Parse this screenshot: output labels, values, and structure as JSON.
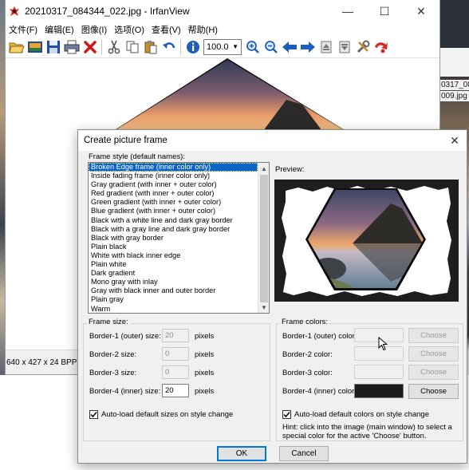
{
  "main_window": {
    "title": "20210317_084344_022.jpg - IrfanView",
    "controls": {
      "minimize": "—",
      "maximize": "☐",
      "close": "✕"
    },
    "menu": [
      "文件(F)",
      "编辑(E)",
      "图像(I)",
      "选项(O)",
      "查看(V)",
      "帮助(H)"
    ],
    "zoom_value": "100.0",
    "status": "640 x 427 x 24 BPP"
  },
  "desktop_right": {
    "line1": "0317_08",
    "line2": "009.jpg"
  },
  "dialog": {
    "title": "Create picture frame",
    "close": "✕",
    "frame_style_label": "Frame style (default names):",
    "frame_styles": [
      "Broken Edge frame (inner color only)",
      "Inside fading frame (inner color only)",
      "Gray gradient (with inner + outer color)",
      "Red gradient (with inner + outer color)",
      "Green gradient (with inner + outer color)",
      "Blue gradient (with inner + outer color)",
      "Black with a white line and dark gray border",
      "Black with a gray line and dark gray border",
      "Black with gray border",
      "Plain black",
      "White with black inner edge",
      "Plain white",
      "Dark gradient",
      "Mono gray with inlay",
      "Gray with black inner and outer border",
      "Plain gray",
      "Warm"
    ],
    "selected_style": "Broken Edge frame (inner color only)",
    "preview_label": "Preview:",
    "frame_size": {
      "title": "Frame size:",
      "rows": [
        {
          "label": "Border-1 (outer) size:",
          "value": "20",
          "unit": "pixels",
          "enabled": false
        },
        {
          "label": "Border-2 size:",
          "value": "0",
          "unit": "pixels",
          "enabled": false
        },
        {
          "label": "Border-3 size:",
          "value": "0",
          "unit": "pixels",
          "enabled": false
        },
        {
          "label": "Border-4 (inner) size:",
          "value": "20",
          "unit": "pixels",
          "enabled": true
        }
      ],
      "autoload_label": "Auto-load default sizes on style change",
      "autoload_checked": true
    },
    "frame_colors": {
      "title": "Frame colors:",
      "rows": [
        {
          "label": "Border-1 (outer) color:",
          "button": "Choose",
          "enabled": false
        },
        {
          "label": "Border-2 color:",
          "button": "Choose",
          "enabled": false
        },
        {
          "label": "Border-3 color:",
          "button": "Choose",
          "enabled": false
        },
        {
          "label": "Border-4 (inner) color:",
          "button": "Choose",
          "enabled": true,
          "color": "#1c1c1c"
        }
      ],
      "autoload_label": "Auto-load default colors on style change",
      "autoload_checked": true,
      "hint_line1": "Hint: click into the image (main window) to select a",
      "hint_line2": "special color for the active 'Choose' button."
    },
    "ok_label": "OK",
    "cancel_label": "Cancel"
  },
  "icons": [
    "app-icon",
    "open-icon",
    "slideshow-icon",
    "save-icon",
    "print-icon",
    "delete-icon",
    "cut-icon",
    "copy-icon",
    "paste-icon",
    "undo-icon",
    "info-icon",
    "zoom-in-icon",
    "zoom-out-icon",
    "previous-icon",
    "next-icon",
    "first-page-icon",
    "last-page-icon",
    "settings-icon",
    "exit-icon",
    "cursor-icon"
  ]
}
